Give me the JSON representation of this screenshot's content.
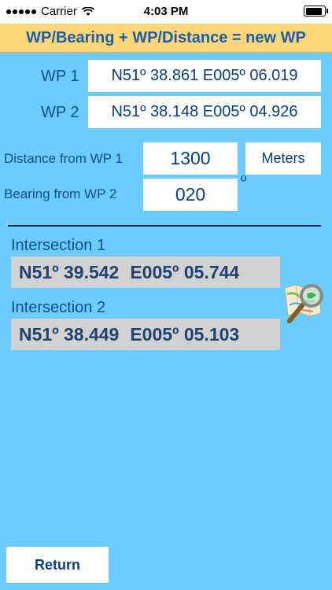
{
  "status_bar": {
    "carrier": "Carrier",
    "time": "4:03 PM",
    "battery_level": 1.0
  },
  "title": "WP/Bearing + WP/Distance = new WP",
  "wp1": {
    "label": "WP 1",
    "value": "N51º 38.861 E005º 06.019"
  },
  "wp2": {
    "label": "WP 2",
    "value": "N51º 38.148 E005º 04.926"
  },
  "distance": {
    "label": "Distance from WP 1",
    "value": "1300",
    "unit_button": "Meters"
  },
  "bearing": {
    "label": "Bearing from WP 2",
    "value": "020",
    "unit": "º"
  },
  "intersection1": {
    "label": "Intersection 1",
    "lat": "N51º 39.542",
    "lon": "E005º 05.744"
  },
  "intersection2": {
    "label": "Intersection 2",
    "lat": "N51º 38.449",
    "lon": "E005º 05.103"
  },
  "map_icon": "map-magnifier-icon",
  "return_label": "Return",
  "colors": {
    "background": "#6ccbff",
    "title_bar": "#ffd57a",
    "text": "#0d4f8b"
  }
}
